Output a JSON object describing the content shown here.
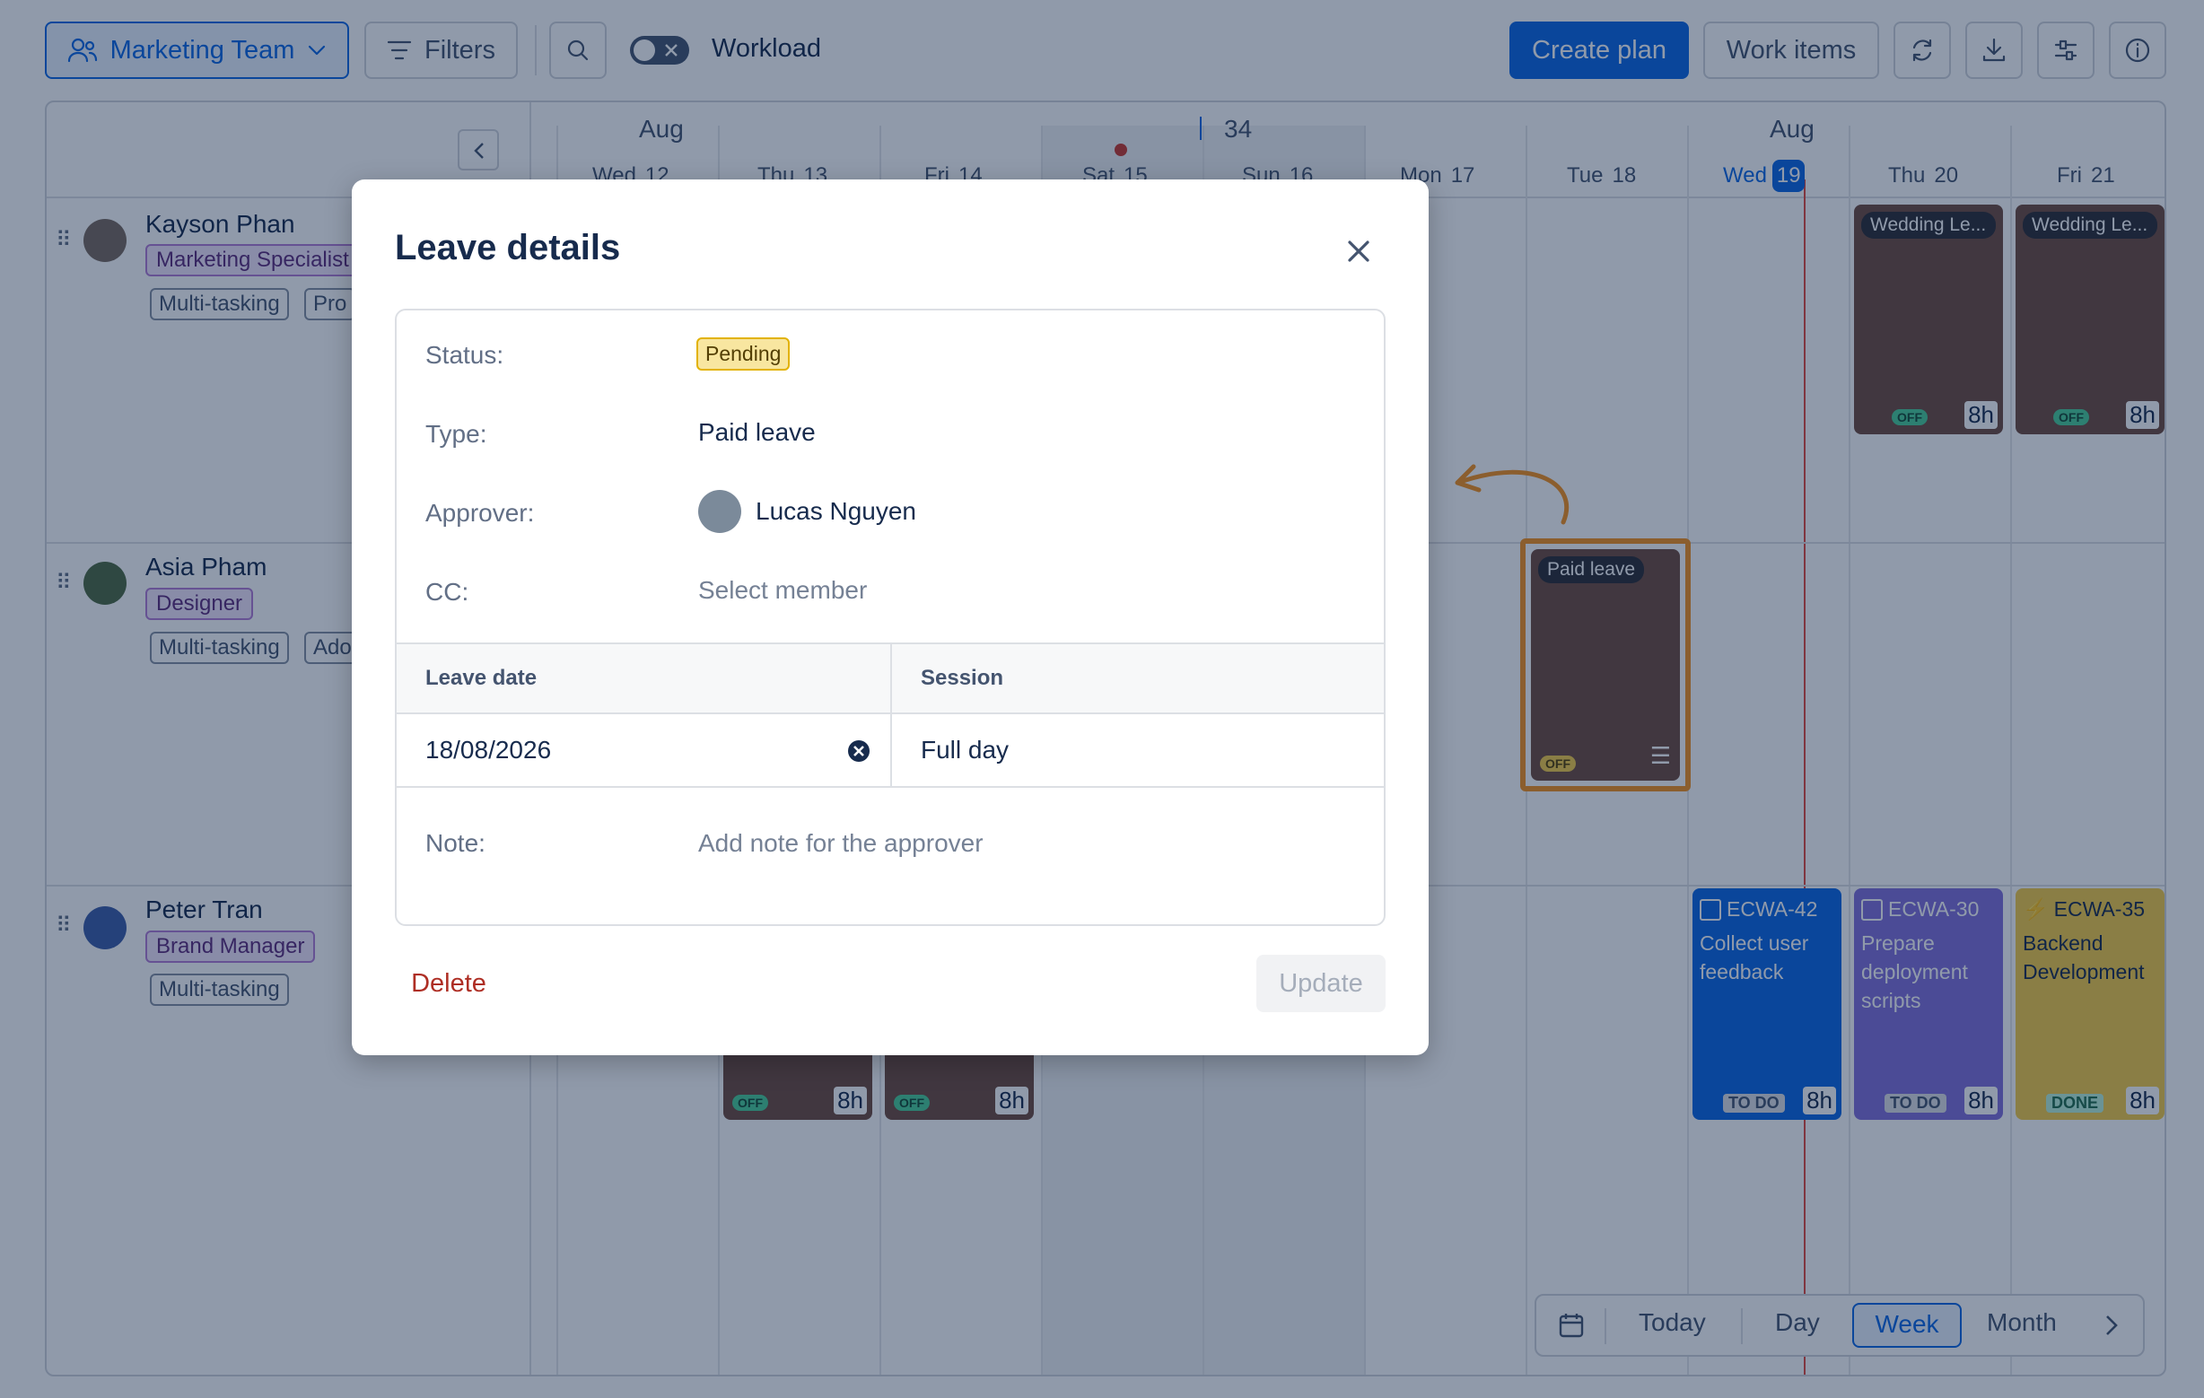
{
  "toolbar": {
    "team_label": "Marketing Team",
    "filters_label": "Filters",
    "workload_label": "Workload",
    "create_plan_label": "Create plan",
    "work_items_label": "Work items"
  },
  "timeline": {
    "months": [
      "Aug",
      "Aug"
    ],
    "week_number": "34",
    "days": [
      {
        "dow": "Wed",
        "date": "12"
      },
      {
        "dow": "Thu",
        "date": "13"
      },
      {
        "dow": "Fri",
        "date": "14"
      },
      {
        "dow": "Sat",
        "date": "15"
      },
      {
        "dow": "Sun",
        "date": "16"
      },
      {
        "dow": "Mon",
        "date": "17"
      },
      {
        "dow": "Tue",
        "date": "18"
      },
      {
        "dow": "Wed",
        "date": "19"
      },
      {
        "dow": "Thu",
        "date": "20"
      },
      {
        "dow": "Fri",
        "date": "21"
      }
    ]
  },
  "people": [
    {
      "name": "Kayson Phan",
      "role": "Marketing Specialist",
      "skills": [
        "Multi-tasking",
        "Pro"
      ]
    },
    {
      "name": "Asia Pham",
      "role": "Designer",
      "skills": [
        "Multi-tasking",
        "Ado"
      ]
    },
    {
      "name": "Peter Tran",
      "role": "Brand Manager",
      "skills": [
        "Multi-tasking"
      ]
    }
  ],
  "cards": {
    "wedding_title": "Wedding Le...",
    "paid_leave_title": "Paid leave",
    "off_label": "OFF",
    "hours": "8h",
    "tasks": [
      {
        "key": "ECWA-42",
        "title": "Collect user feedback",
        "status": "TO DO",
        "hours": "8h"
      },
      {
        "key": "ECWA-30",
        "title": "Prepare deployment scripts",
        "status": "TO DO",
        "hours": "8h"
      },
      {
        "key": "ECWA-35",
        "title": "Backend Development",
        "status": "DONE",
        "hours": "8h"
      }
    ]
  },
  "modal": {
    "title": "Leave details",
    "status_label": "Status:",
    "status_value": "Pending",
    "type_label": "Type:",
    "type_value": "Paid leave",
    "approver_label": "Approver:",
    "approver_value": "Lucas Nguyen",
    "cc_label": "CC:",
    "cc_placeholder": "Select member",
    "table_header_date": "Leave date",
    "table_header_session": "Session",
    "leave_date": "18/08/2026",
    "session": "Full day",
    "note_label": "Note:",
    "note_placeholder": "Add note for the approver",
    "delete_label": "Delete",
    "update_label": "Update"
  },
  "bottom_nav": {
    "today": "Today",
    "day": "Day",
    "week": "Week",
    "month": "Month"
  },
  "colors": {
    "brand": "#0c66e4",
    "highlight_orange": "#f6921e",
    "leave_card": "#6f4b3e"
  }
}
